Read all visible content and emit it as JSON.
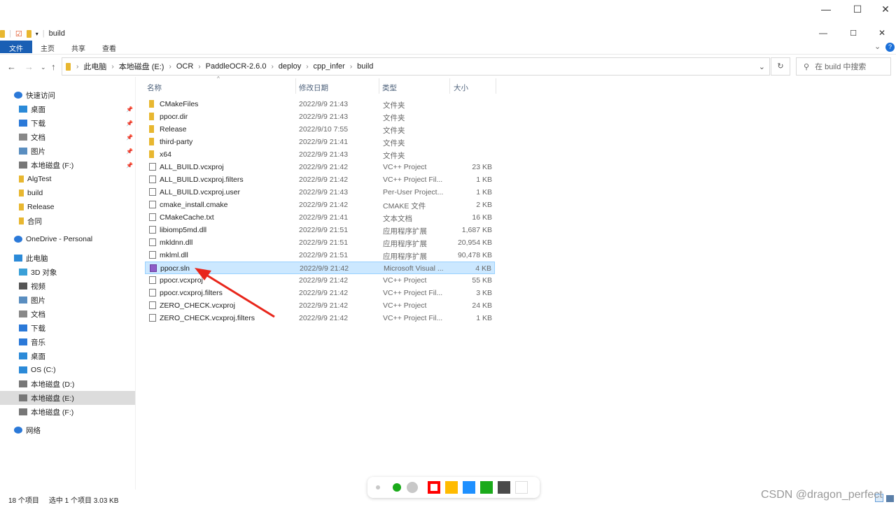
{
  "window": {
    "title": "build",
    "min": "—",
    "max": "☐",
    "close": "✕"
  },
  "ribbon": {
    "tabs": [
      "文件",
      "主页",
      "共享",
      "查看"
    ],
    "help": "?",
    "expand": "⌄"
  },
  "address": {
    "crumbs": [
      "此电脑",
      "本地磁盘 (E:)",
      "OCR",
      "PaddleOCR-2.6.0",
      "deploy",
      "cpp_infer",
      "build"
    ],
    "search_placeholder": "在 build 中搜索"
  },
  "sidebar": [
    {
      "label": "快速访问",
      "icon": "star-icon",
      "color": "#2b79d8",
      "indent": 0
    },
    {
      "label": "桌面",
      "icon": "desktop-icon",
      "color": "#2b8ad8",
      "indent": 1,
      "pin": true
    },
    {
      "label": "下载",
      "icon": "download-icon",
      "color": "#2b79d8",
      "indent": 1,
      "pin": true
    },
    {
      "label": "文档",
      "icon": "document-icon",
      "color": "#888",
      "indent": 1,
      "pin": true
    },
    {
      "label": "图片",
      "icon": "pictures-icon",
      "color": "#5a8ec0",
      "indent": 1,
      "pin": true
    },
    {
      "label": "本地磁盘 (F:)",
      "icon": "drive-icon",
      "color": "#777",
      "indent": 1,
      "pin": true
    },
    {
      "label": "AlgTest",
      "icon": "folder-icon",
      "color": "#e8b730",
      "indent": 1
    },
    {
      "label": "build",
      "icon": "folder-icon",
      "color": "#e8b730",
      "indent": 1
    },
    {
      "label": "Release",
      "icon": "folder-icon",
      "color": "#e8b730",
      "indent": 1
    },
    {
      "label": "合同",
      "icon": "folder-icon",
      "color": "#e8b730",
      "indent": 1
    },
    {
      "label": "OneDrive - Personal",
      "icon": "cloud-icon",
      "color": "#2b79d8",
      "indent": 0,
      "gap": 6
    },
    {
      "label": "此电脑",
      "icon": "computer-icon",
      "color": "#2b8ad8",
      "indent": 0,
      "gap": 7
    },
    {
      "label": "3D 对象",
      "icon": "3d-objects-icon",
      "color": "#3aa0d8",
      "indent": 1
    },
    {
      "label": "视频",
      "icon": "video-icon",
      "color": "#555",
      "indent": 1
    },
    {
      "label": "图片",
      "icon": "pictures-icon",
      "color": "#5a8ec0",
      "indent": 1
    },
    {
      "label": "文档",
      "icon": "document-icon",
      "color": "#888",
      "indent": 1
    },
    {
      "label": "下载",
      "icon": "download-icon",
      "color": "#2b79d8",
      "indent": 1
    },
    {
      "label": "音乐",
      "icon": "music-icon",
      "color": "#2b79d8",
      "indent": 1
    },
    {
      "label": "桌面",
      "icon": "desktop-icon",
      "color": "#2b8ad8",
      "indent": 1
    },
    {
      "label": "OS (C:)",
      "icon": "windows-drive-icon",
      "color": "#2b8ad8",
      "indent": 1
    },
    {
      "label": "本地磁盘 (D:)",
      "icon": "drive-icon",
      "color": "#777",
      "indent": 1
    },
    {
      "label": "本地磁盘 (E:)",
      "icon": "drive-icon",
      "color": "#777",
      "indent": 1,
      "selected": true
    },
    {
      "label": "本地磁盘 (F:)",
      "icon": "drive-icon",
      "color": "#777",
      "indent": 1
    },
    {
      "label": "网络",
      "icon": "network-icon",
      "color": "#2b79d8",
      "indent": 0,
      "gap": 6
    }
  ],
  "columns": {
    "name": "名称",
    "date": "修改日期",
    "type": "类型",
    "size": "大小"
  },
  "files": [
    {
      "name": "CMakeFiles",
      "date": "2022/9/9 21:43",
      "type": "文件夹",
      "size": "",
      "kind": "folder"
    },
    {
      "name": "ppocr.dir",
      "date": "2022/9/9 21:43",
      "type": "文件夹",
      "size": "",
      "kind": "folder"
    },
    {
      "name": "Release",
      "date": "2022/9/10 7:55",
      "type": "文件夹",
      "size": "",
      "kind": "folder"
    },
    {
      "name": "third-party",
      "date": "2022/9/9 21:41",
      "type": "文件夹",
      "size": "",
      "kind": "folder"
    },
    {
      "name": "x64",
      "date": "2022/9/9 21:43",
      "type": "文件夹",
      "size": "",
      "kind": "folder"
    },
    {
      "name": "ALL_BUILD.vcxproj",
      "date": "2022/9/9 21:42",
      "type": "VC++ Project",
      "size": "23 KB",
      "kind": "file"
    },
    {
      "name": "ALL_BUILD.vcxproj.filters",
      "date": "2022/9/9 21:42",
      "type": "VC++ Project Fil...",
      "size": "1 KB",
      "kind": "file"
    },
    {
      "name": "ALL_BUILD.vcxproj.user",
      "date": "2022/9/9 21:43",
      "type": "Per-User Project...",
      "size": "1 KB",
      "kind": "file"
    },
    {
      "name": "cmake_install.cmake",
      "date": "2022/9/9 21:42",
      "type": "CMAKE 文件",
      "size": "2 KB",
      "kind": "file"
    },
    {
      "name": "CMakeCache.txt",
      "date": "2022/9/9 21:41",
      "type": "文本文档",
      "size": "16 KB",
      "kind": "file"
    },
    {
      "name": "libiomp5md.dll",
      "date": "2022/9/9 21:51",
      "type": "应用程序扩展",
      "size": "1,687 KB",
      "kind": "file"
    },
    {
      "name": "mkldnn.dll",
      "date": "2022/9/9 21:51",
      "type": "应用程序扩展",
      "size": "20,954 KB",
      "kind": "file"
    },
    {
      "name": "mklml.dll",
      "date": "2022/9/9 21:51",
      "type": "应用程序扩展",
      "size": "90,478 KB",
      "kind": "file"
    },
    {
      "name": "ppocr.sln",
      "date": "2022/9/9 21:42",
      "type": "Microsoft Visual ...",
      "size": "4 KB",
      "kind": "sln",
      "selected": true
    },
    {
      "name": "ppocr.vcxproj",
      "date": "2022/9/9 21:42",
      "type": "VC++ Project",
      "size": "55 KB",
      "kind": "file"
    },
    {
      "name": "ppocr.vcxproj.filters",
      "date": "2022/9/9 21:42",
      "type": "VC++ Project Fil...",
      "size": "3 KB",
      "kind": "file"
    },
    {
      "name": "ZERO_CHECK.vcxproj",
      "date": "2022/9/9 21:42",
      "type": "VC++ Project",
      "size": "24 KB",
      "kind": "file"
    },
    {
      "name": "ZERO_CHECK.vcxproj.filters",
      "date": "2022/9/9 21:42",
      "type": "VC++ Project Fil...",
      "size": "1 KB",
      "kind": "file"
    }
  ],
  "status": {
    "count": "18 个项目",
    "selection": "选中 1 个项目 3.03 KB"
  },
  "annotation": {
    "colors": [
      "#ff0000",
      "#ffbb00",
      "#1e90ff",
      "#1aaa1a",
      "#4a4a4a",
      "#ffffff"
    ],
    "arrow_color": "#e8261b"
  },
  "watermark": "CSDN @dragon_perfect"
}
